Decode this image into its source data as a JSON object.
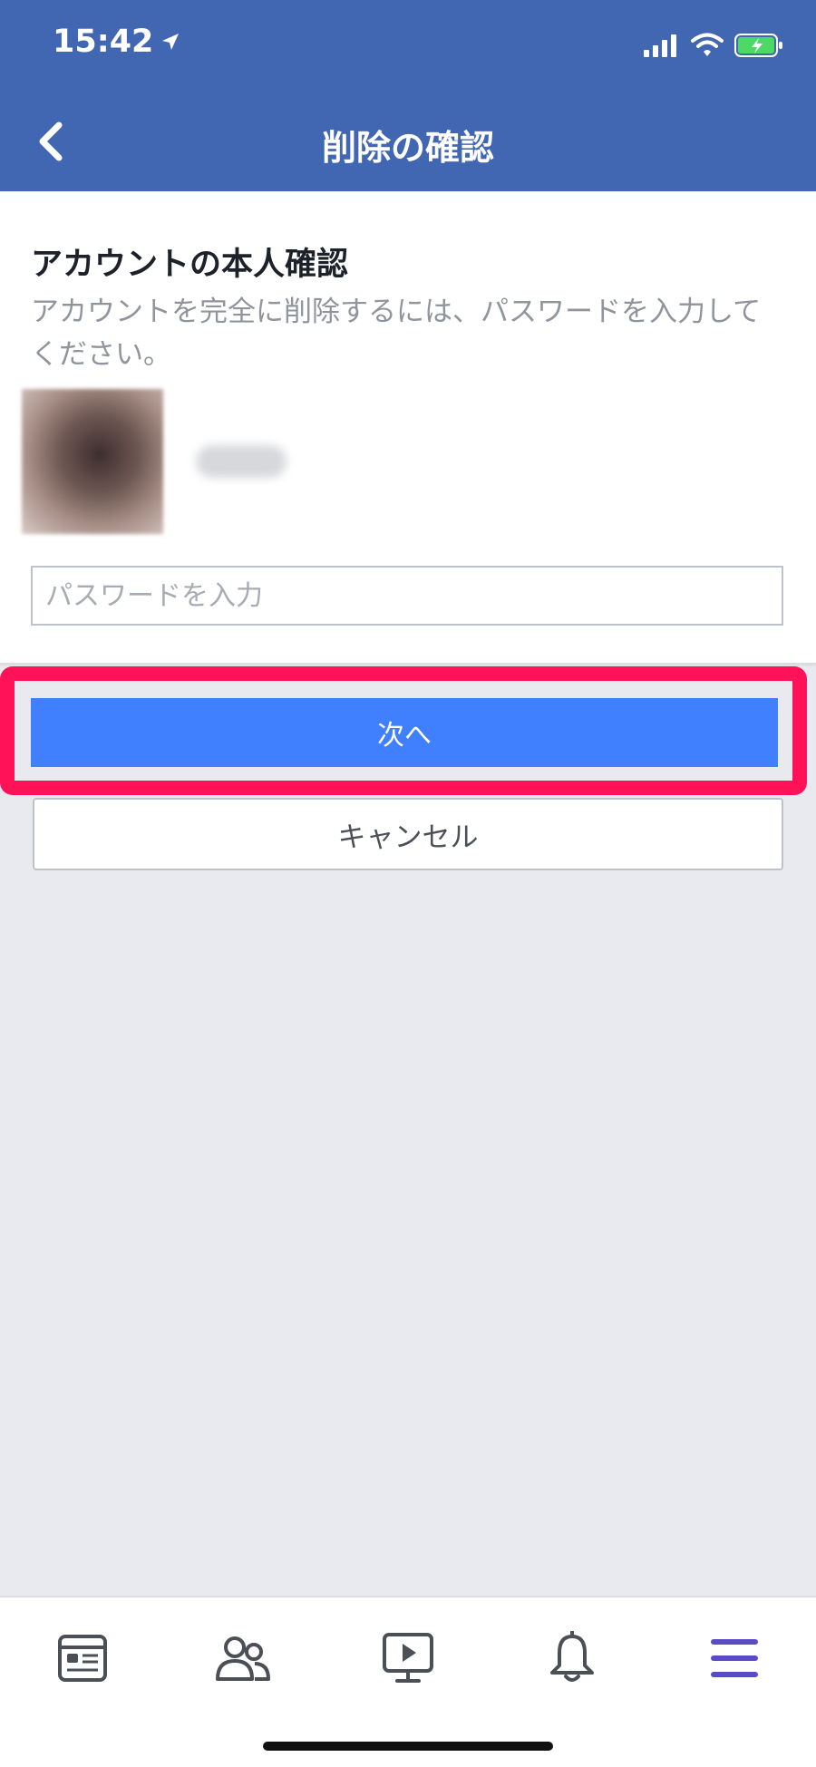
{
  "status_bar": {
    "time": "15:42",
    "location_icon": "location-arrow-icon",
    "signal_icon": "cellular-signal-icon",
    "wifi_icon": "wifi-icon",
    "battery_icon": "battery-charging-icon"
  },
  "nav": {
    "back_icon": "chevron-left-icon",
    "title": "削除の確認"
  },
  "card": {
    "title": "アカウントの本人確認",
    "description": "アカウントを完全に削除するには、パスワードを入力してください。",
    "password_placeholder": "パスワードを入力",
    "password_value": ""
  },
  "actions": {
    "next_label": "次へ",
    "cancel_label": "キャンセル"
  },
  "tab_bar": {
    "items": [
      {
        "icon": "news-feed-icon"
      },
      {
        "icon": "friends-icon"
      },
      {
        "icon": "watch-video-icon"
      },
      {
        "icon": "bell-icon"
      },
      {
        "icon": "menu-icon",
        "active": true
      }
    ]
  },
  "colors": {
    "header_bg": "#4267b2",
    "primary_button": "#4080ff",
    "highlight_border": "#ff1258",
    "page_bg": "#e9eaef",
    "active_tab": "#5c4bc9"
  }
}
